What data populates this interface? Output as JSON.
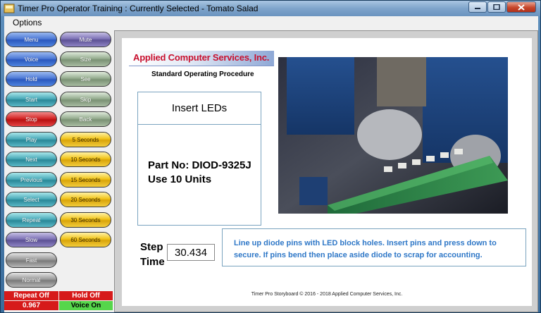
{
  "window": {
    "title": "Timer Pro Operator Training : Currently Selected - Tomato Salad"
  },
  "menu": {
    "options_label": "Options"
  },
  "left_buttons": {
    "menu": "Menu",
    "mute": "Mute",
    "voice": "Voice",
    "size": "Size",
    "hold": "Hold",
    "see": "See",
    "start": "Start",
    "skip": "Skip",
    "stop": "Stop",
    "back": "Back",
    "play": "Play",
    "sec5": "5 Seconds",
    "next": "Next",
    "sec10": "10 Seconds",
    "previous": "Previous",
    "sec15": "15 Seconds",
    "select": "Select",
    "sec20": "20 Seconds",
    "repeat": "Repeat",
    "sec30": "30 Seconds",
    "slow": "Slow",
    "sec60": "60 Seconds",
    "fast": "Fast",
    "normal": "Normal"
  },
  "status": {
    "repeat_off": "Repeat Off",
    "hold_off": "Hold Off",
    "speed": "0.967",
    "voice_on": "Voice On"
  },
  "sop": {
    "company": "Applied Computer Services, Inc.",
    "subtitle": "Standard Operating Procedure",
    "step_title": "Insert LEDs",
    "part_no": "Part No: DIOD-9325J",
    "use_units": "Use 10 Units",
    "step_label_line1": "Step",
    "step_label_line2": "Time",
    "step_time": "30.434",
    "instruction_line1": "Line up diode pins with LED block holes.  Insert pins and  press down to",
    "instruction_line2": "secure. If pins bend then place aside diode to scrap for accounting.",
    "footer": "Timer Pro Storyboard © 2016 - 2018 Applied Computer Services, Inc."
  },
  "colors": {
    "status_red": "#d61a1a",
    "status_green": "#56d64b",
    "instruction_blue": "#2e77c7",
    "logo_red": "#c8102e"
  }
}
